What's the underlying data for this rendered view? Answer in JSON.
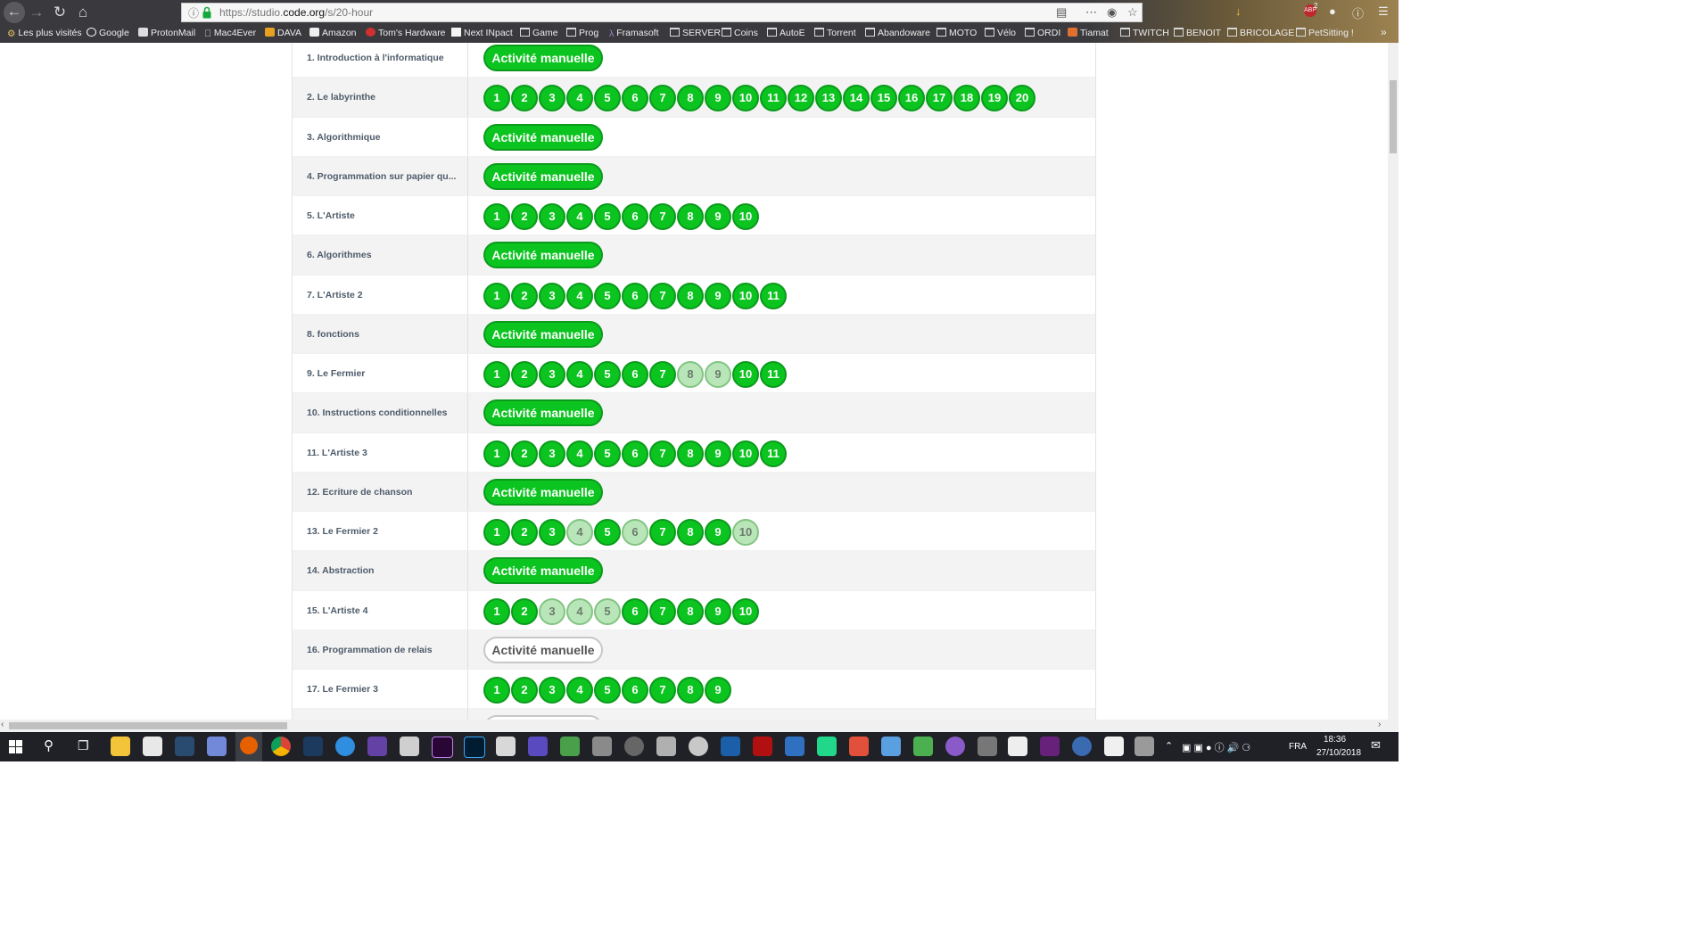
{
  "browser": {
    "url_prefix": "https://studio.",
    "url_domain": "code.org",
    "url_suffix": "/s/20-hour",
    "notification_count": "2",
    "bookmarks": [
      "Les plus visités",
      "Google",
      "ProtonMail",
      "Mac4Ever",
      "DAVA",
      "Amazon",
      "Tom's Hardware",
      "Next INpact",
      "Game",
      "Prog",
      "Framasoft",
      "SERVER",
      "Coins",
      "AutoE",
      "Torrent",
      "Abandoware",
      "MOTO",
      "Vélo",
      "ORDI",
      "Tiamat",
      "TWITCH",
      "BENOIT",
      "BRICOLAGE",
      "PetSitting !"
    ]
  },
  "lessons": [
    {
      "name": "1. Introduction à l'informatique",
      "type": "activity",
      "label": "Activité manuelle",
      "done": true
    },
    {
      "name": "2. Le labyrinthe",
      "type": "levels",
      "count": 20,
      "faded": []
    },
    {
      "name": "3. Algorithmique",
      "type": "activity",
      "label": "Activité manuelle",
      "done": true
    },
    {
      "name": "4. Programmation sur papier qu...",
      "type": "activity",
      "label": "Activité manuelle",
      "done": true
    },
    {
      "name": "5. L'Artiste",
      "type": "levels",
      "count": 10,
      "faded": []
    },
    {
      "name": "6. Algorithmes",
      "type": "activity",
      "label": "Activité manuelle",
      "done": true
    },
    {
      "name": "7. L'Artiste 2",
      "type": "levels",
      "count": 11,
      "faded": []
    },
    {
      "name": "8. fonctions",
      "type": "activity",
      "label": "Activité manuelle",
      "done": true
    },
    {
      "name": "9. Le Fermier",
      "type": "levels",
      "count": 11,
      "faded": [
        8,
        9
      ]
    },
    {
      "name": "10. Instructions conditionnelles",
      "type": "activity",
      "label": "Activité manuelle",
      "done": true
    },
    {
      "name": "11. L'Artiste 3",
      "type": "levels",
      "count": 11,
      "faded": []
    },
    {
      "name": "12. Ecriture de chanson",
      "type": "activity",
      "label": "Activité manuelle",
      "done": true
    },
    {
      "name": "13. Le Fermier 2",
      "type": "levels",
      "count": 10,
      "faded": [
        4,
        6,
        10
      ]
    },
    {
      "name": "14. Abstraction",
      "type": "activity",
      "label": "Activité manuelle",
      "done": true
    },
    {
      "name": "15. L'Artiste 4",
      "type": "levels",
      "count": 10,
      "faded": [
        3,
        4,
        5
      ]
    },
    {
      "name": "16. Programmation de relais",
      "type": "activity",
      "label": "Activité manuelle",
      "done": false
    },
    {
      "name": "17. Le Fermier 3",
      "type": "levels",
      "count": 9,
      "faded": []
    }
  ],
  "colors": {
    "completed": "#0cc41f",
    "completed_border": "#0b9a1c",
    "attempted": "#b9e6b9",
    "lesson_text": "#4d5b6a"
  },
  "taskbar": {
    "language": "FRA",
    "time": "18:36",
    "date": "27/10/2018"
  }
}
